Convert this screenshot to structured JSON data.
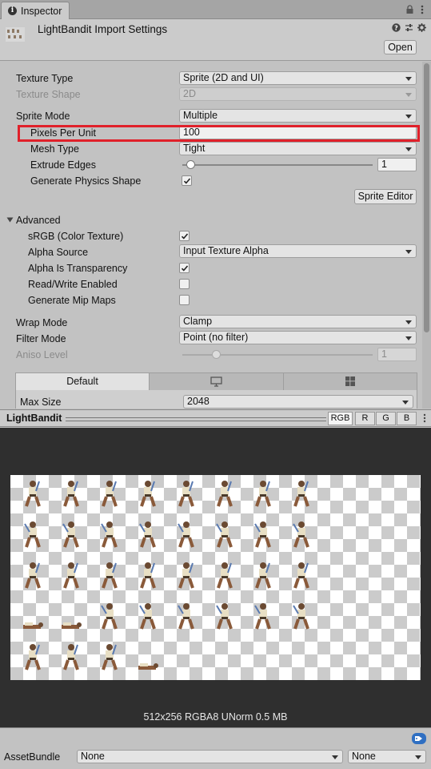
{
  "tab": {
    "label": "Inspector"
  },
  "header": {
    "title": "LightBandit Import Settings",
    "open_label": "Open"
  },
  "fields": {
    "texture_type": {
      "label": "Texture Type",
      "value": "Sprite (2D and UI)"
    },
    "texture_shape": {
      "label": "Texture Shape",
      "value": "2D"
    },
    "sprite_mode": {
      "label": "Sprite Mode",
      "value": "Multiple"
    },
    "pixels_per_unit": {
      "label": "Pixels Per Unit",
      "value": "100"
    },
    "mesh_type": {
      "label": "Mesh Type",
      "value": "Tight"
    },
    "extrude_edges": {
      "label": "Extrude Edges",
      "value": "1",
      "slider_fraction": 0.02
    },
    "generate_physics_shape": {
      "label": "Generate Physics Shape",
      "checked": true
    },
    "sprite_editor_label": "Sprite Editor",
    "advanced_label": "Advanced",
    "srgb": {
      "label": "sRGB (Color Texture)",
      "checked": true
    },
    "alpha_source": {
      "label": "Alpha Source",
      "value": "Input Texture Alpha"
    },
    "alpha_is_transparency": {
      "label": "Alpha Is Transparency",
      "checked": true
    },
    "read_write": {
      "label": "Read/Write Enabled",
      "checked": false
    },
    "mip_maps": {
      "label": "Generate Mip Maps",
      "checked": false
    },
    "wrap_mode": {
      "label": "Wrap Mode",
      "value": "Clamp"
    },
    "filter_mode": {
      "label": "Filter Mode",
      "value": "Point (no filter)"
    },
    "aniso_level": {
      "label": "Aniso Level",
      "value": "1",
      "slider_fraction": 0.0
    }
  },
  "platform_tabs": {
    "default_label": "Default",
    "icons": [
      "monitor-icon",
      "windows-icon"
    ]
  },
  "max_size": {
    "label": "Max Size",
    "value": "2048"
  },
  "preview": {
    "title": "LightBandit",
    "channels": [
      "RGB",
      "R",
      "G",
      "B"
    ],
    "info": "512x256  RGBA8 UNorm  0.5 MB"
  },
  "asset_bundle": {
    "label": "AssetBundle",
    "name_value": "None",
    "variant_value": "None"
  },
  "colors": {
    "highlight": "#e0202a",
    "preview_bg": "#2f2f2f"
  }
}
